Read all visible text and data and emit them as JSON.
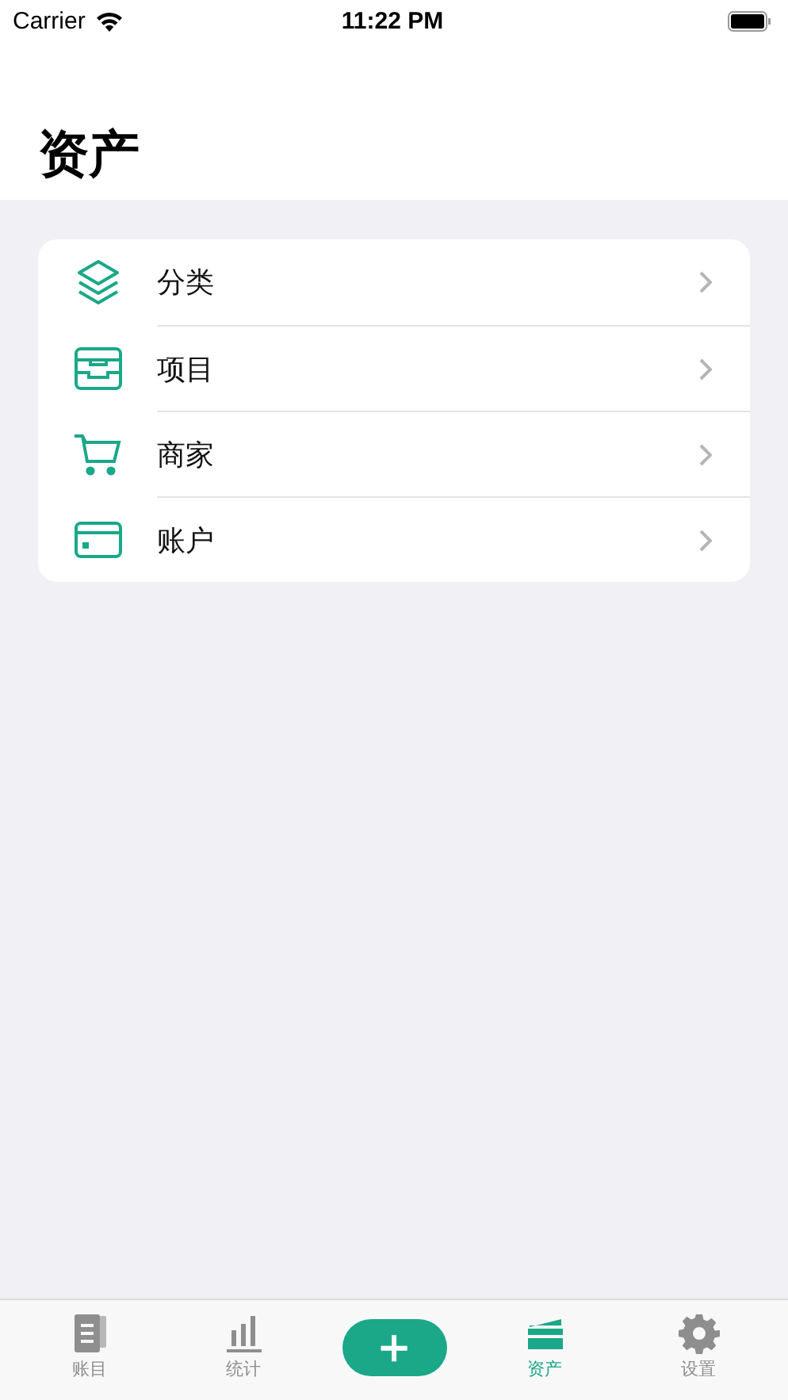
{
  "status_bar": {
    "carrier": "Carrier",
    "time": "11:22 PM"
  },
  "title": "资产",
  "menu": [
    {
      "label": "分类",
      "kind": "layers"
    },
    {
      "label": "项目",
      "kind": "tray"
    },
    {
      "label": "商家",
      "kind": "cart"
    },
    {
      "label": "账户",
      "kind": "card"
    }
  ],
  "tab_bar": [
    {
      "kind": "ledger",
      "label": "账目",
      "selected": false
    },
    {
      "kind": "stats",
      "label": "统计",
      "selected": false
    },
    {
      "kind": "add",
      "label": "＋"
    },
    {
      "kind": "assets",
      "label": "资产",
      "selected": true
    },
    {
      "kind": "settings",
      "label": "设置",
      "selected": false
    }
  ]
}
